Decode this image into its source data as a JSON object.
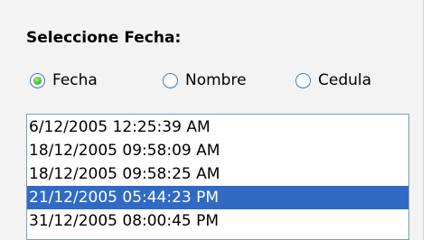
{
  "panel": {
    "heading": "Seleccione Fecha:"
  },
  "radio_group": {
    "options": [
      {
        "label": "Fecha",
        "checked": true
      },
      {
        "label": "Nombre",
        "checked": false
      },
      {
        "label": "Cedula",
        "checked": false
      }
    ]
  },
  "list": {
    "items": [
      {
        "text": "6/12/2005 12:25:39 AM",
        "selected": false
      },
      {
        "text": "18/12/2005 09:58:09 AM",
        "selected": false
      },
      {
        "text": "18/12/2005 09:58:25 AM",
        "selected": false
      },
      {
        "text": "21/12/2005 05:44:23 PM",
        "selected": true
      },
      {
        "text": "31/12/2005 08:00:45 PM",
        "selected": false
      }
    ],
    "selected_color": "#316ac5"
  },
  "colors": {
    "panel_background": "#f3f3f3",
    "list_border": "#7f9db9",
    "radio_border": "#4a7ea8",
    "radio_checked": "#3fbf3a"
  }
}
